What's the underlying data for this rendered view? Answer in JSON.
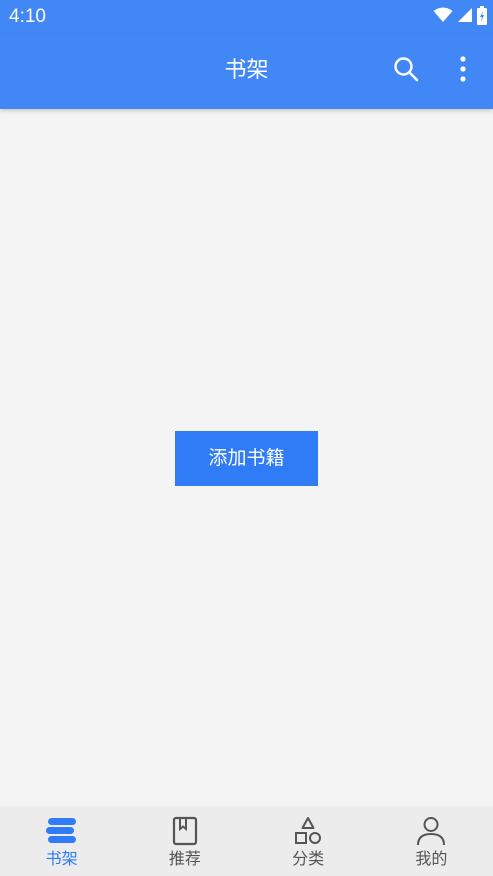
{
  "status_bar": {
    "time": "4:10"
  },
  "app_bar": {
    "title": "书架",
    "actions": [
      "search-icon",
      "more-vert-icon"
    ]
  },
  "content": {
    "add_button_label": "添加书籍"
  },
  "bottom_nav": {
    "items": [
      {
        "label": "书架",
        "icon": "bookshelf-icon",
        "active": true
      },
      {
        "label": "推荐",
        "icon": "book-icon",
        "active": false
      },
      {
        "label": "分类",
        "icon": "shapes-icon",
        "active": false
      },
      {
        "label": "我的",
        "icon": "person-icon",
        "active": false
      }
    ]
  },
  "colors": {
    "primary": "#4188f6",
    "button": "#2f7cf6",
    "background": "#f4f4f4",
    "nav_background": "#ececec",
    "inactive": "#555555"
  }
}
